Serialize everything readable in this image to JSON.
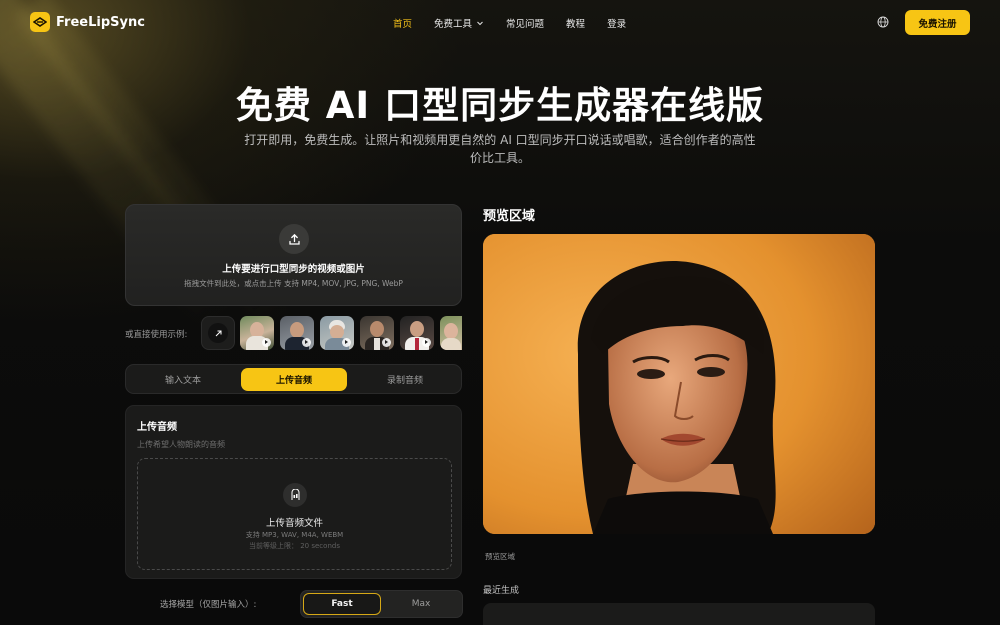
{
  "brand": {
    "name": "FreeLipSync",
    "accent": "#f7c514"
  },
  "nav": {
    "items": [
      {
        "label": "首页",
        "active": true
      },
      {
        "label": "免费工具",
        "dropdown": true
      },
      {
        "label": "常见问题"
      },
      {
        "label": "教程"
      },
      {
        "label": "登录"
      }
    ],
    "language_icon": "globe-icon",
    "cta": "免费注册"
  },
  "hero": {
    "title": "免费 AI 口型同步生成器在线版",
    "subtitle": "打开即用，免费生成。让照片和视频用更自然的 AI 口型同步开口说话或唱歌，适合创作者的高性价比工具。"
  },
  "upload": {
    "icon": "upload-icon",
    "title": "上传要进行口型同步的视频或图片",
    "subtitle": "拖拽文件到此处，或点击上传 支持 MP4, MOV, JPG, PNG, WebP"
  },
  "examples": {
    "label": "或直接使用示例:",
    "link_icon": "arrow-up-right-icon",
    "thumbnails": [
      {
        "name": "example-woman-outdoor"
      },
      {
        "name": "example-man-suit"
      },
      {
        "name": "example-older-woman"
      },
      {
        "name": "example-man-vest"
      },
      {
        "name": "example-man-shirt"
      },
      {
        "name": "example-woman-partial"
      }
    ]
  },
  "tabs": {
    "items": [
      "输入文本",
      "上传音频",
      "录制音频"
    ],
    "active_index": 1
  },
  "audio": {
    "title": "上传音频",
    "subtitle": "上传希望人物朗读的音频",
    "dropzone": {
      "icon": "audio-file-icon",
      "title": "上传音频文件",
      "formats": "支持 MP3, WAV, M4A, WEBM",
      "limit": "当前等级上限： 20 seconds"
    }
  },
  "model": {
    "label": "选择模型（仅图片输入）:",
    "options": [
      "Fast",
      "Max"
    ],
    "selected": "Fast"
  },
  "preview": {
    "title": "预览区域",
    "caption": "预览区域"
  },
  "recent": {
    "title": "最近生成"
  }
}
